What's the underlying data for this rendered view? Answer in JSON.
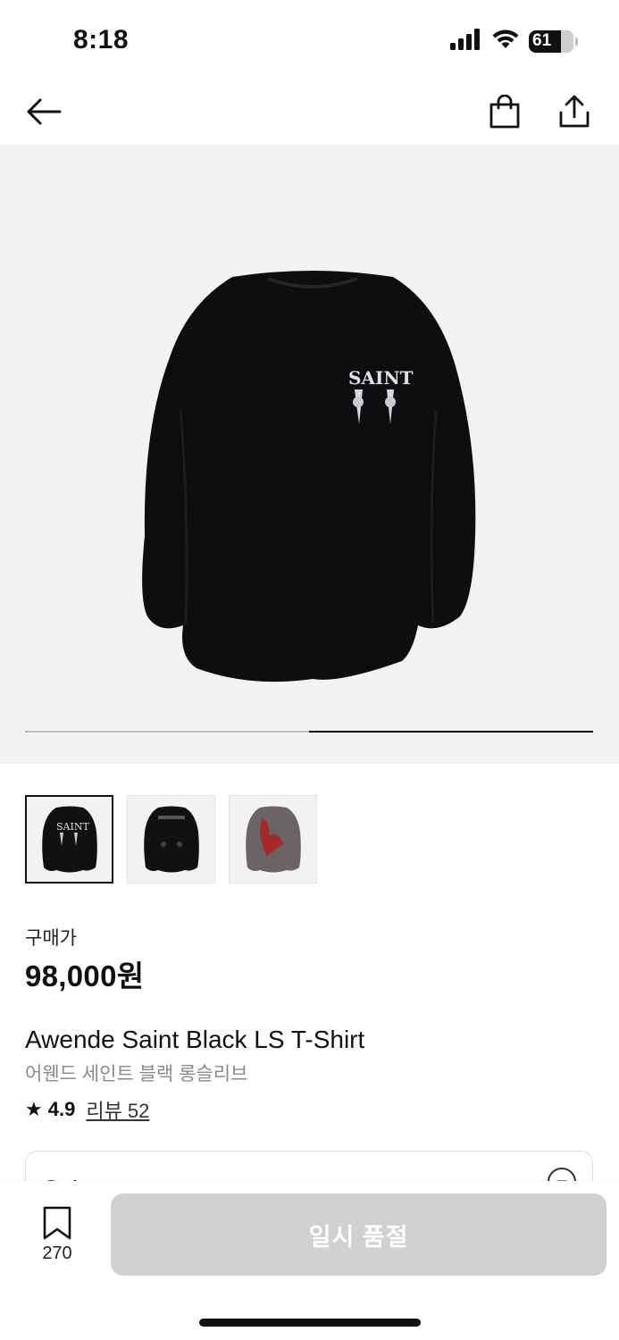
{
  "status_bar": {
    "time": "8:18",
    "battery_level": "61",
    "icons": [
      "signal-icon",
      "wifi-icon",
      "battery-icon"
    ]
  },
  "nav": {
    "icons": [
      "back-arrow-icon",
      "shopping-bag-icon",
      "share-icon"
    ]
  },
  "gallery": {
    "image_alt": "black long sleeve t-shirt",
    "thumbnail_count": 3,
    "selected_thumbnail": 1,
    "thumbnail_descriptions": [
      "black long sleeve (front)",
      "black long sleeve (back)",
      "grey long sleeve (red print)"
    ],
    "pager": {
      "total": 2,
      "current": 2
    }
  },
  "price": {
    "label": "구매가",
    "value": "98,000원"
  },
  "product": {
    "title_en": "Awende Saint Black LS T-Shirt",
    "title_ko": "어웬드 세인트 블랙 롱슬리브",
    "rating": "4.9",
    "review_label": "리뷰 52"
  },
  "option": {
    "label": "옵션"
  },
  "bottom_bar": {
    "wish_count": "270",
    "soldout_label": "일시 품절"
  },
  "colors": {
    "text": "#111111",
    "subtext": "#8a8a8a",
    "hero_bg": "#f2f2f2",
    "button_disabled": "#d0d0d0"
  }
}
